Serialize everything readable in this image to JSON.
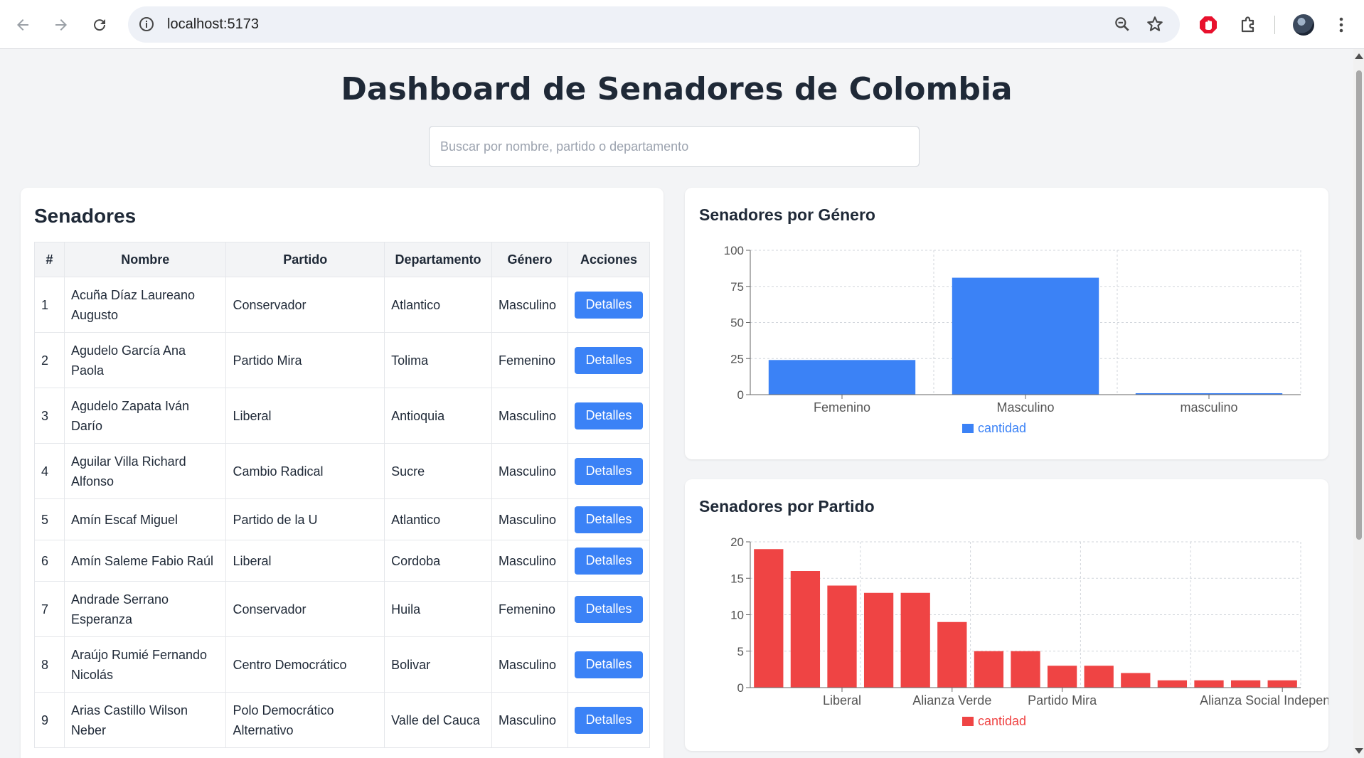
{
  "browser": {
    "url": "localhost:5173"
  },
  "page": {
    "title": "Dashboard de Senadores de Colombia",
    "search_placeholder": "Buscar por nombre, partido o departamento"
  },
  "senators_table": {
    "title": "Senadores",
    "columns": [
      "#",
      "Nombre",
      "Partido",
      "Departamento",
      "Género",
      "Acciones"
    ],
    "action_label": "Detalles",
    "rows": [
      {
        "num": "1",
        "nombre": "Acuña Díaz Laureano Augusto",
        "partido": "Conservador",
        "departamento": "Atlantico",
        "genero": "Masculino"
      },
      {
        "num": "2",
        "nombre": "Agudelo García Ana Paola",
        "partido": "Partido Mira",
        "departamento": "Tolima",
        "genero": "Femenino"
      },
      {
        "num": "3",
        "nombre": "Agudelo Zapata Iván Darío",
        "partido": "Liberal",
        "departamento": "Antioquia",
        "genero": "Masculino"
      },
      {
        "num": "4",
        "nombre": "Aguilar Villa Richard Alfonso",
        "partido": "Cambio Radical",
        "departamento": "Sucre",
        "genero": "Masculino"
      },
      {
        "num": "5",
        "nombre": "Amín Escaf Miguel",
        "partido": "Partido de la U",
        "departamento": "Atlantico",
        "genero": "Masculino"
      },
      {
        "num": "6",
        "nombre": "Amín Saleme Fabio Raúl",
        "partido": "Liberal",
        "departamento": "Cordoba",
        "genero": "Masculino"
      },
      {
        "num": "7",
        "nombre": "Andrade Serrano Esperanza",
        "partido": "Conservador",
        "departamento": "Huila",
        "genero": "Femenino"
      },
      {
        "num": "8",
        "nombre": "Araújo Rumié Fernando Nicolás",
        "partido": "Centro Democrático",
        "departamento": "Bolivar",
        "genero": "Masculino"
      },
      {
        "num": "9",
        "nombre": "Arias Castillo Wilson Neber",
        "partido": "Polo Democrático Alternativo",
        "departamento": "Valle del Cauca",
        "genero": "Masculino"
      }
    ]
  },
  "chart_data": [
    {
      "type": "bar",
      "title": "Senadores por Género",
      "categories": [
        "Femenino",
        "Masculino",
        "masculino"
      ],
      "series": [
        {
          "name": "cantidad",
          "values": [
            24,
            81,
            1
          ]
        }
      ],
      "ylim": [
        0,
        100
      ],
      "yticks": [
        0,
        25,
        50,
        75,
        100
      ],
      "grid": true,
      "legend_position": "bottom",
      "color": "#3b82f6"
    },
    {
      "type": "bar",
      "title": "Senadores por Partido",
      "categories": [
        "",
        "",
        "Liberal",
        "",
        "",
        "Alianza Verde",
        "",
        "",
        "Partido Mira",
        "",
        "",
        "",
        "",
        "",
        "Alianza Social Independiente"
      ],
      "series": [
        {
          "name": "cantidad",
          "values": [
            19,
            16,
            14,
            13,
            13,
            9,
            5,
            5,
            3,
            3,
            2,
            1,
            1,
            1,
            1
          ]
        }
      ],
      "ylim": [
        0,
        20
      ],
      "yticks": [
        0,
        5,
        10,
        15,
        20
      ],
      "grid": true,
      "legend_position": "bottom",
      "color": "#ef4444"
    }
  ]
}
